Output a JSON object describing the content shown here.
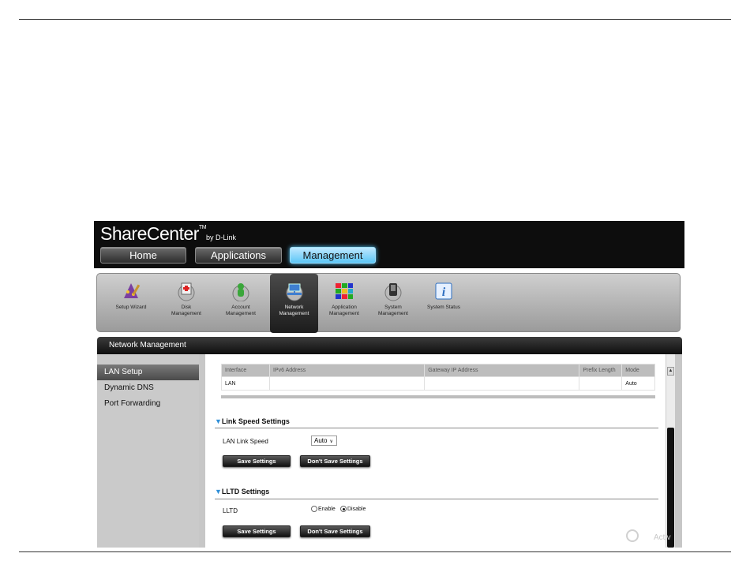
{
  "app": {
    "brand": "ShareCenter",
    "brand_tm": "TM",
    "brand_by": "by D-Link"
  },
  "nav": {
    "home": "Home",
    "applications": "Applications",
    "management": "Management"
  },
  "tools": [
    {
      "label1": "Setup Wizard",
      "label2": ""
    },
    {
      "label1": "Disk",
      "label2": "Management"
    },
    {
      "label1": "Account",
      "label2": "Management"
    },
    {
      "label1": "Network",
      "label2": "Management"
    },
    {
      "label1": "Application",
      "label2": "Management"
    },
    {
      "label1": "System",
      "label2": "Management"
    },
    {
      "label1": "System Status",
      "label2": ""
    }
  ],
  "section": {
    "title": "Network Management"
  },
  "sidebar": {
    "items": [
      "LAN Setup",
      "Dynamic DNS",
      "Port Forwarding"
    ]
  },
  "ipv6_table": {
    "headers": [
      "Interface",
      "IPv6 Address",
      "Gateway IP Address",
      "Prefix Length",
      "Mode"
    ],
    "rows": [
      [
        "LAN",
        "",
        "",
        "",
        "Auto"
      ]
    ]
  },
  "link_speed": {
    "heading": "Link Speed Settings",
    "label": "LAN Link Speed",
    "value": "Auto",
    "save": "Save Settings",
    "dont_save": "Don't Save Settings"
  },
  "lltd": {
    "heading": "LLTD Settings",
    "label": "LLTD",
    "enable": "Enable",
    "disable": "Disable",
    "selected": "Disable",
    "save": "Save Settings",
    "dont_save": "Don't Save Settings"
  },
  "watermark": "Activ",
  "colors": {
    "accent": "#5cc6f6",
    "heading_triangle": "#2f8fd8"
  }
}
